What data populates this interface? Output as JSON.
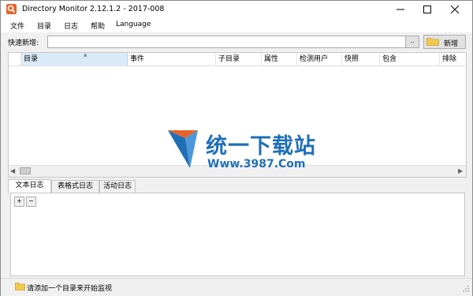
{
  "window": {
    "title": "Directory Monitor 2.12.1.2 - 2017-008",
    "controls": [
      "minimize",
      "maximize",
      "close"
    ]
  },
  "menu": {
    "items": [
      "文件",
      "目录",
      "日志",
      "帮助",
      "Language"
    ]
  },
  "quick_add": {
    "label": "快速新增:",
    "value": "",
    "placeholder": "",
    "browse_label": "..",
    "add_label": "新增"
  },
  "grid": {
    "columns": [
      "目录",
      "事件",
      "子目录",
      "属性",
      "检测用户",
      "快照",
      "包含",
      "排除"
    ],
    "rows": []
  },
  "watermark": {
    "cn": "统一下载站",
    "url": "Www.3987.Com"
  },
  "log_tabs": [
    "文本日志",
    "表格式日志",
    "活动日志"
  ],
  "log_panel": {
    "zoom_in": "+",
    "zoom_out": "−"
  },
  "status": {
    "text": "请添加一个目录来开始监视"
  },
  "colors": {
    "accent": "#e8632a",
    "selected_header": "#d9ebf9",
    "watermark_blue": "#1f6fb6",
    "watermark_orange": "#e8632a",
    "folder": "#f2c94c"
  }
}
